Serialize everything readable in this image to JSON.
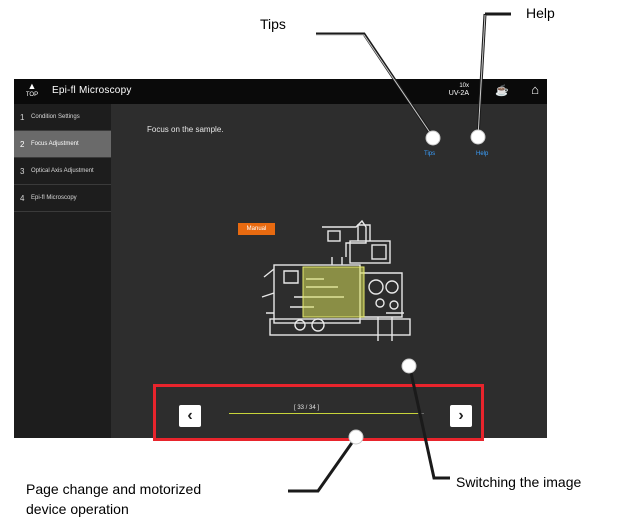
{
  "callouts": {
    "tips": "Tips",
    "help": "Help",
    "switching": "Switching the image",
    "pager_line1": "Page change and motorized",
    "pager_line2": "device operation"
  },
  "topbar": {
    "home_label": "TOP",
    "title": "Epi-fl Microscopy",
    "objective": "10x",
    "filter": "UV-2A"
  },
  "steps": [
    {
      "num": "1",
      "label": "Condition Settings",
      "active": false
    },
    {
      "num": "2",
      "label": "Focus Adjustment",
      "active": true
    },
    {
      "num": "3",
      "label": "Optical Axis Adjustment",
      "active": false
    },
    {
      "num": "4",
      "label": "Epi-fl Microscopy",
      "active": false
    }
  ],
  "main": {
    "instruction": "Focus on the sample.",
    "tips_link": "Tips",
    "help_link": "Help",
    "mode_badge": "Manual"
  },
  "pager": {
    "count": "[ 33 / 34 ]",
    "progress": 0.97
  },
  "colors": {
    "highlight": "#e8242c",
    "accent_link": "#3aa0ff",
    "badge": "#e86a10",
    "progress": "#c8d43a"
  }
}
